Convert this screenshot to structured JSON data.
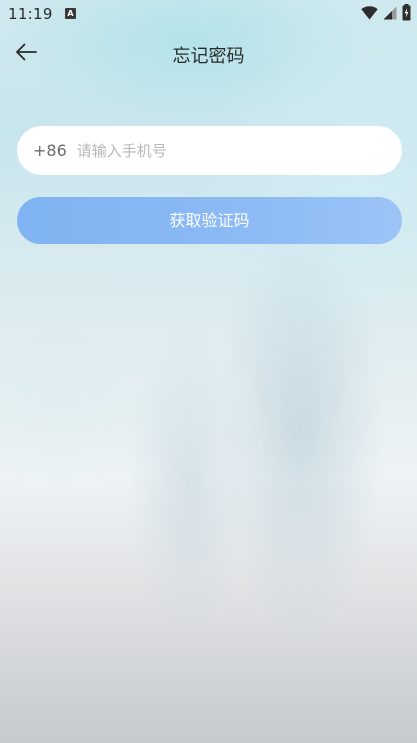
{
  "status_bar": {
    "time": "11:19",
    "app_icon_glyph": "A",
    "icons": [
      "wifi-icon",
      "cellular-signal-icon",
      "battery-icon"
    ]
  },
  "header": {
    "back_icon": "arrow-left-icon",
    "title": "忘记密码"
  },
  "form": {
    "country_code": "+86",
    "phone_placeholder": "请输入手机号",
    "phone_value": "",
    "submit_label": "获取验证码"
  },
  "colors": {
    "button_gradient_start": "#80b3f2",
    "button_gradient_end": "#9cc4f7",
    "button_text": "#ffffff",
    "placeholder": "#b7b7bd"
  }
}
